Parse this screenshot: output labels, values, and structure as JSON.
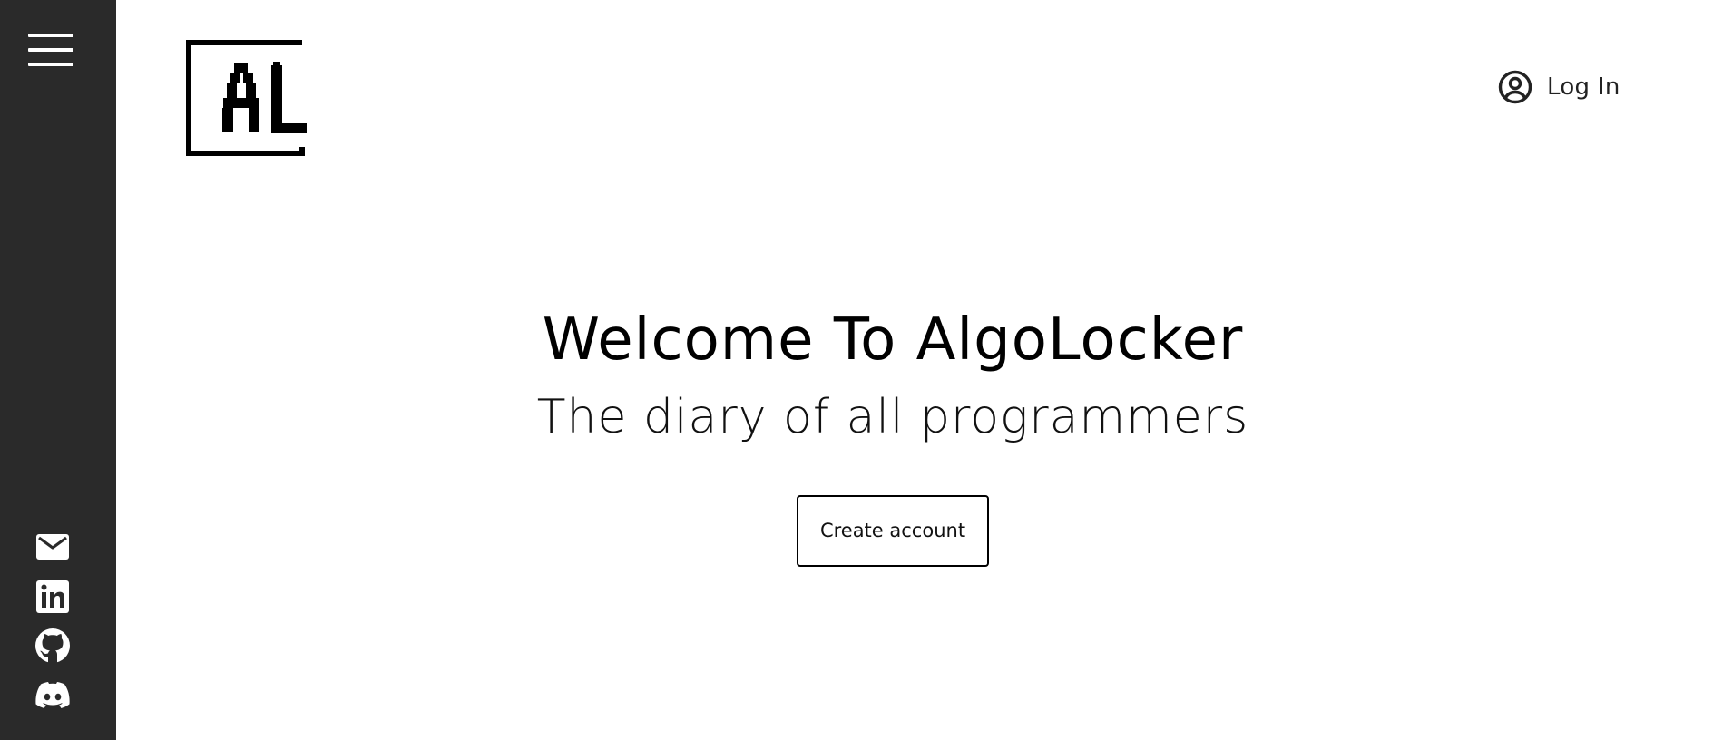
{
  "sidebar": {
    "menu_icon": "hamburger-menu-icon",
    "social_links": [
      {
        "icon": "email-icon"
      },
      {
        "icon": "linkedin-icon"
      },
      {
        "icon": "github-icon"
      },
      {
        "icon": "discord-icon"
      }
    ],
    "background_color": "#2a2a2a"
  },
  "header": {
    "logo_text": "AL",
    "login_label": "Log In",
    "login_icon": "user-circle-icon"
  },
  "hero": {
    "title": "Welcome To AlgoLocker",
    "subtitle": "The diary of all programmers",
    "cta_label": "Create account"
  }
}
